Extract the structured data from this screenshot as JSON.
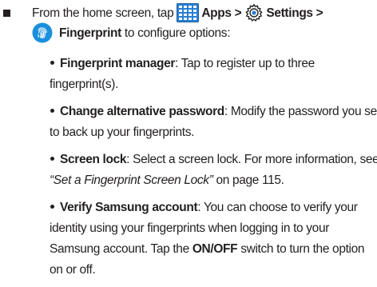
{
  "step": {
    "from_text": "From the home screen, tap",
    "apps_label": "Apps >",
    "settings_label": "Settings >",
    "fingerprint_label": "Fingerprint",
    "configure_text": "to configure options:"
  },
  "options": [
    {
      "title": "Fingerprint manager",
      "line1": ": Tap to register up to three",
      "line2": "fingerprint(s)."
    },
    {
      "title": "Change alternative password",
      "line1": ": Modify the password you set",
      "line2": "to back up your fingerprints."
    },
    {
      "title": "Screen lock",
      "line1": ": Select a screen lock. For more information, see",
      "link": "“Set a Fingerprint Screen Lock”",
      "after_link": " on page 115."
    },
    {
      "title": "Verify Samsung account",
      "line1": ": You can choose to verify your",
      "line2": "identity using your fingerprints when logging in to your",
      "line3_a": "Samsung account. Tap the ",
      "switch_label": "ON/OFF",
      "line3_b": " switch to turn the option",
      "line4": "on or off."
    }
  ],
  "icons": {
    "apps": "apps-grid-icon",
    "settings": "settings-gear-icon",
    "fingerprint": "fingerprint-icon"
  },
  "colors": {
    "text": "#231f20",
    "apps_icon": "#2a7fd4",
    "fingerprint_icon": "#1a8fdc"
  }
}
